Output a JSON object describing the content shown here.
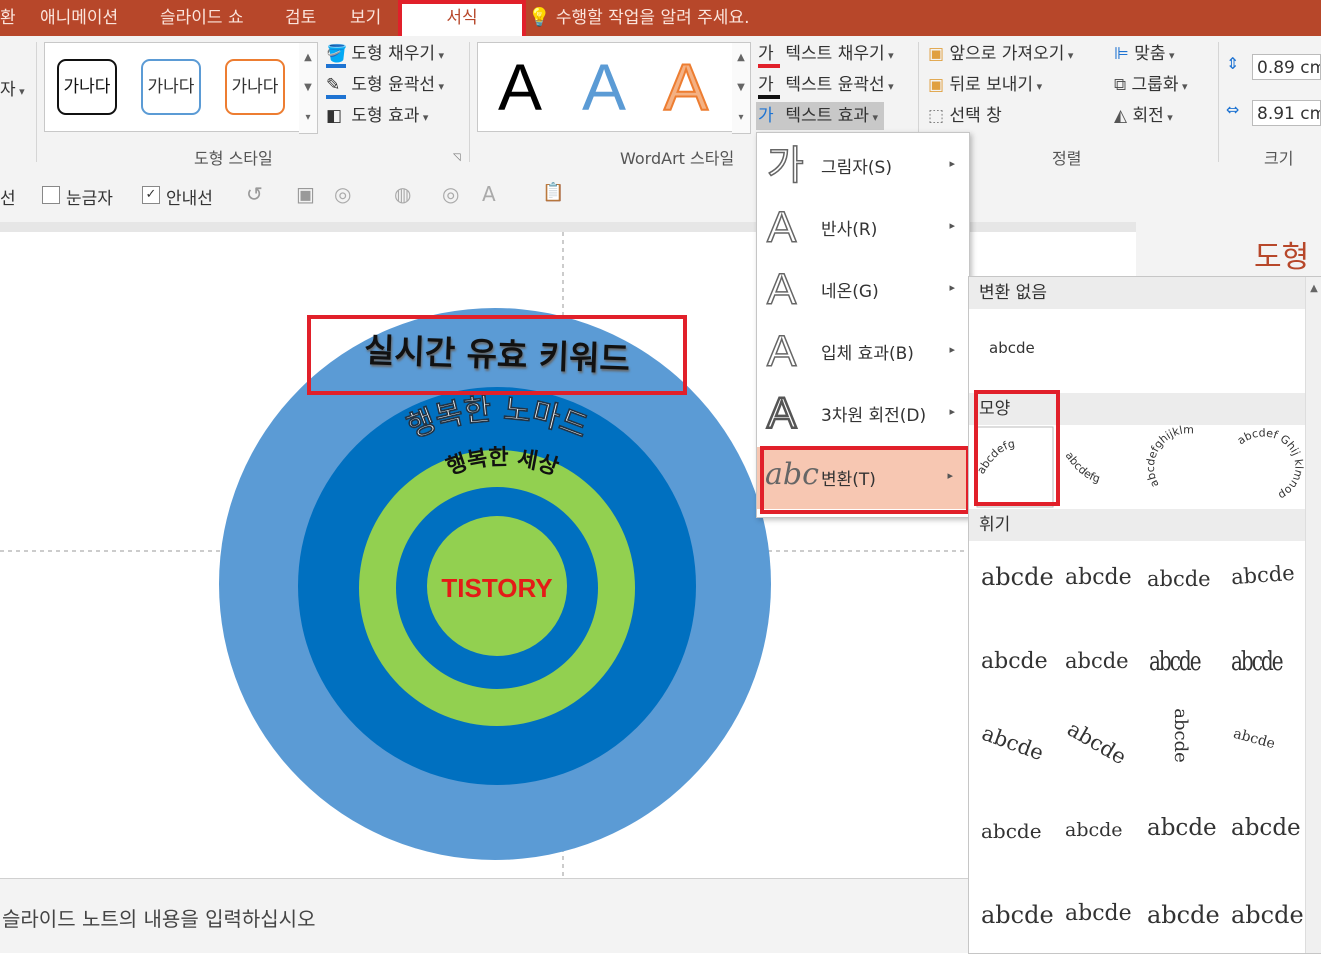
{
  "tabs": {
    "t0": "환",
    "t1": "애니메이션",
    "t2": "슬라이드 쇼",
    "t3": "검토",
    "t4": "보기",
    "t5": "서식",
    "tellme": "수행할 작업을 알려 주세요."
  },
  "ribbon": {
    "left_cut": {
      "a": "자"
    },
    "shape_styles": {
      "label": "도형 스타일",
      "samples": [
        "가나다",
        "가나다",
        "가나다"
      ],
      "fill": "도형 채우기",
      "outline": "도형 윤곽선",
      "effects": "도형 효과"
    },
    "wordart": {
      "label": "WordArt 스타일",
      "sample": "A",
      "text_fill": "텍스트 채우기",
      "text_outline": "텍스트 윤곽선",
      "text_effects": "텍스트 효과",
      "fill_icon_char": "가",
      "outline_icon_char": "가",
      "effects_icon_char": "가"
    },
    "arrange": {
      "label": "정렬",
      "bring_forward": "앞으로 가져오기",
      "send_backward": "뒤로 보내기",
      "selection_pane": "선택 창",
      "align": "맞춤",
      "group": "그룹화",
      "rotate": "회전"
    },
    "size": {
      "label": "크기",
      "height": "0.89 cm",
      "width": "8.91 cm"
    }
  },
  "bar2": {
    "cut": "선",
    "ruler": "눈금자",
    "guides": "안내선"
  },
  "slide": {
    "keyword": "실시간 유효 키워드",
    "ring1": "행복한 노마드",
    "ring2": "행복한 세상",
    "center": "TISTORY",
    "pane_title": "도형"
  },
  "notes": {
    "placeholder": "슬라이드 노트의 내용을 입력하십시오"
  },
  "fx_menu": {
    "items": [
      {
        "label": "그림자(S)",
        "glyph": "가"
      },
      {
        "label": "반사(R)",
        "glyph": "A"
      },
      {
        "label": "네온(G)",
        "glyph": "A"
      },
      {
        "label": "입체 효과(B)",
        "glyph": "A"
      },
      {
        "label": "3차원 회전(D)",
        "glyph": "A"
      },
      {
        "label": "변환(T)",
        "glyph": "abc"
      }
    ]
  },
  "transform": {
    "no_transform": "변환 없음",
    "no_transform_sample": "abcde",
    "shape": "모양",
    "shape_samples": [
      "abcdefg",
      "abcdefg",
      "abcdefghijklm",
      "abcdef Ghij klmnop"
    ],
    "warp": "휘기",
    "warp_sample": "abcde"
  },
  "colors": {
    "accent": "#b7472a",
    "highlight": "#e1202a",
    "ring_outer": "#5b9bd5",
    "ring_dark": "#0070c0",
    "ring_green": "#92d050",
    "center_text": "#e41b17"
  }
}
